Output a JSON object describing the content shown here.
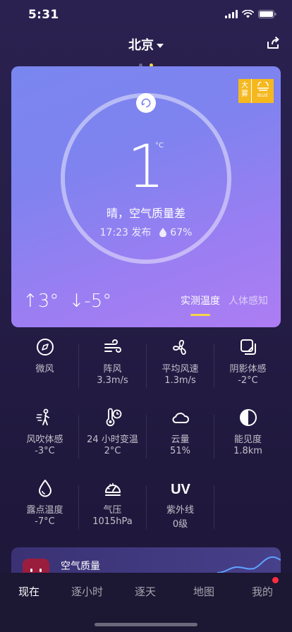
{
  "status": {
    "time": "5:31"
  },
  "header": {
    "city": "北京",
    "page_count": 2,
    "active_page": 2
  },
  "card": {
    "badge_top": "大",
    "badge_bottom": "雾",
    "badge_right": "BLUE",
    "temperature": "1",
    "unit": "°C",
    "condition": "晴，空气质量差",
    "publish_time": "17:23 发布",
    "humidity": "67%",
    "high": "↑3°",
    "low": "↓-5°",
    "mode_active": "实测温度",
    "mode_other": "人体感知"
  },
  "metrics": [
    {
      "icon": "compass-icon",
      "label": "微风",
      "value": ""
    },
    {
      "icon": "wind-icon",
      "label": "阵风",
      "value": "3.3m/s"
    },
    {
      "icon": "fan-icon",
      "label": "平均风速",
      "value": "1.3m/s"
    },
    {
      "icon": "shade-icon",
      "label": "阴影体感",
      "value": "-2°C"
    },
    {
      "icon": "windchill-icon",
      "label": "风吹体感",
      "value": "-3°C"
    },
    {
      "icon": "thermometer-clock-icon",
      "label": "24 小时变温",
      "value": "2°C"
    },
    {
      "icon": "cloud-icon",
      "label": "云量",
      "value": "51%"
    },
    {
      "icon": "visibility-icon",
      "label": "能见度",
      "value": "1.8km"
    },
    {
      "icon": "dewpoint-icon",
      "label": "露点温度",
      "value": "-7°C"
    },
    {
      "icon": "gauge-icon",
      "label": "气压",
      "value": "1015hPa"
    },
    {
      "icon": "uv-icon",
      "label": "紫外线",
      "value": "0级"
    }
  ],
  "aqi": {
    "title": "空气质量"
  },
  "tabs": [
    "现在",
    "逐小时",
    "逐天",
    "地图",
    "我的"
  ],
  "colors": {
    "accent": "#f5d547",
    "notify": "#ff2d3e"
  }
}
